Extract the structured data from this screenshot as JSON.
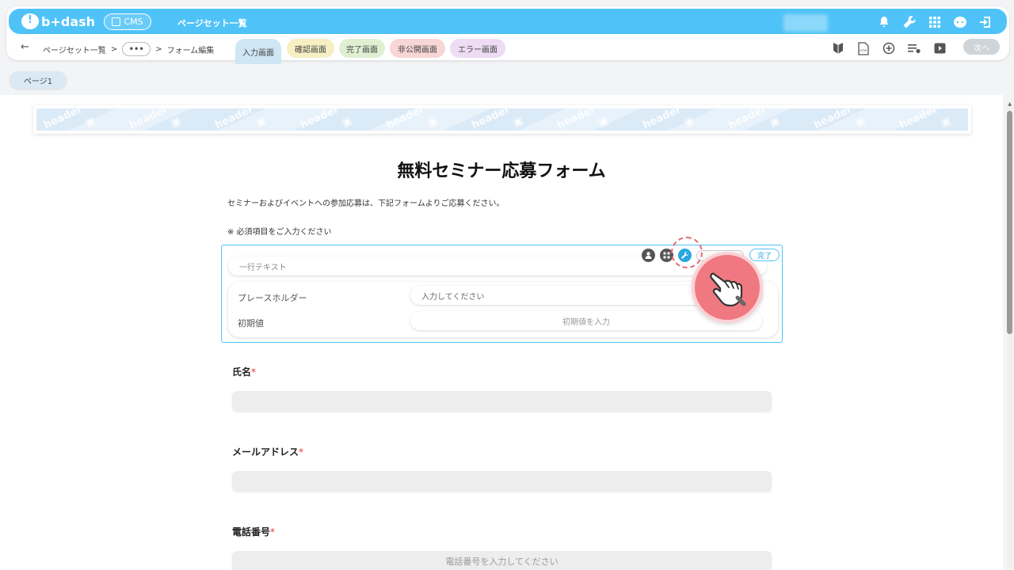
{
  "topbar": {
    "logo_text": "b+dash",
    "cms_label": "CMS",
    "title": "ページセット一覧",
    "icons": [
      "bell-icon",
      "wrench-icon",
      "apps-grid-icon",
      "support-icon",
      "logout-icon"
    ]
  },
  "nav": {
    "breadcrumb_1": "ページセット一覧",
    "sep": ">",
    "dots": "•••",
    "breadcrumb_3": "フォーム編集",
    "tabs": [
      {
        "label": "入力画面",
        "color": "#cfe6f4"
      },
      {
        "label": "確認画面",
        "color": "#f6efc3"
      },
      {
        "label": "完了画面",
        "color": "#dff0d2"
      },
      {
        "label": "非公開画面",
        "color": "#f8d6d6"
      },
      {
        "label": "エラー画面",
        "color": "#eddcf4"
      }
    ],
    "next_label": "次へ"
  },
  "page_tab": "ページ1",
  "header_banner_word": "header",
  "form": {
    "title": "無料セミナー応募フォーム",
    "description": "セミナーおよびイベントへの参加応募は、下記フォームよりご応募ください。",
    "required_note": "※ 必須項目をご入力ください",
    "edit_block": {
      "field_type": "一行テキスト",
      "done_label": "完了",
      "placeholder_label": "プレースホルダー",
      "placeholder_value": "入力してください",
      "initial_label": "初期値",
      "initial_placeholder": "初期値を入力"
    },
    "fields": [
      {
        "label": "氏名",
        "placeholder": ""
      },
      {
        "label": "メールアドレス",
        "placeholder": ""
      },
      {
        "label": "電話番号",
        "placeholder": "電話番号を入力してください"
      }
    ],
    "required_mark": "*"
  }
}
